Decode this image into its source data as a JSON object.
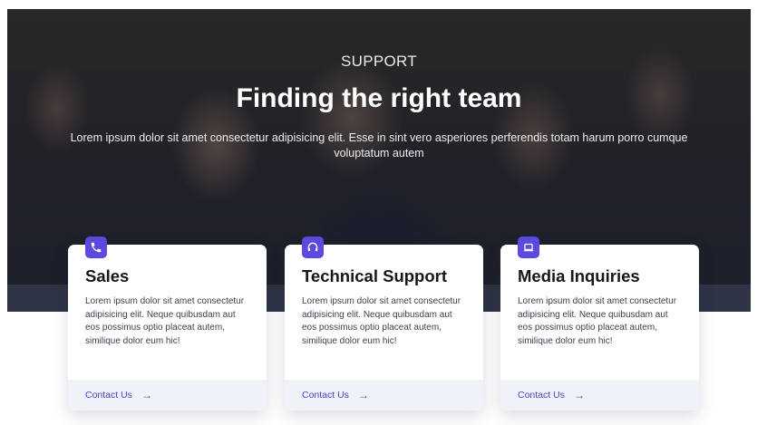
{
  "hero": {
    "eyebrow": "SUPPORT",
    "title": "Finding the right team",
    "lead": "Lorem ipsum dolor sit amet consectetur adipisicing elit. Esse in sint vero asperiores perferendis totam harum porro cumque voluptatum autem"
  },
  "cards": [
    {
      "icon": "phone-icon",
      "title": "Sales",
      "text": "Lorem ipsum dolor sit amet consectetur adipisicing elit. Neque quibusdam aut eos possimus optio placeat autem, similique dolor eum hic!",
      "link": "Contact Us",
      "arrow": "→"
    },
    {
      "icon": "headset-icon",
      "title": "Technical Support",
      "text": "Lorem ipsum dolor sit amet consectetur adipisicing elit. Neque quibusdam aut eos possimus optio placeat autem, similique dolor eum hic!",
      "link": "Contact Us",
      "arrow": "→"
    },
    {
      "icon": "laptop-icon",
      "title": "Media Inquiries",
      "text": "Lorem ipsum dolor sit amet consectetur adipisicing elit. Neque quibusdam aut eos possimus optio placeat autem, similique dolor eum hic!",
      "link": "Contact Us",
      "arrow": "→"
    }
  ],
  "colors": {
    "accent": "#5b4ae0",
    "link": "#4b44c7",
    "footer_bg": "#eff2f8",
    "band": "#2e3445"
  }
}
